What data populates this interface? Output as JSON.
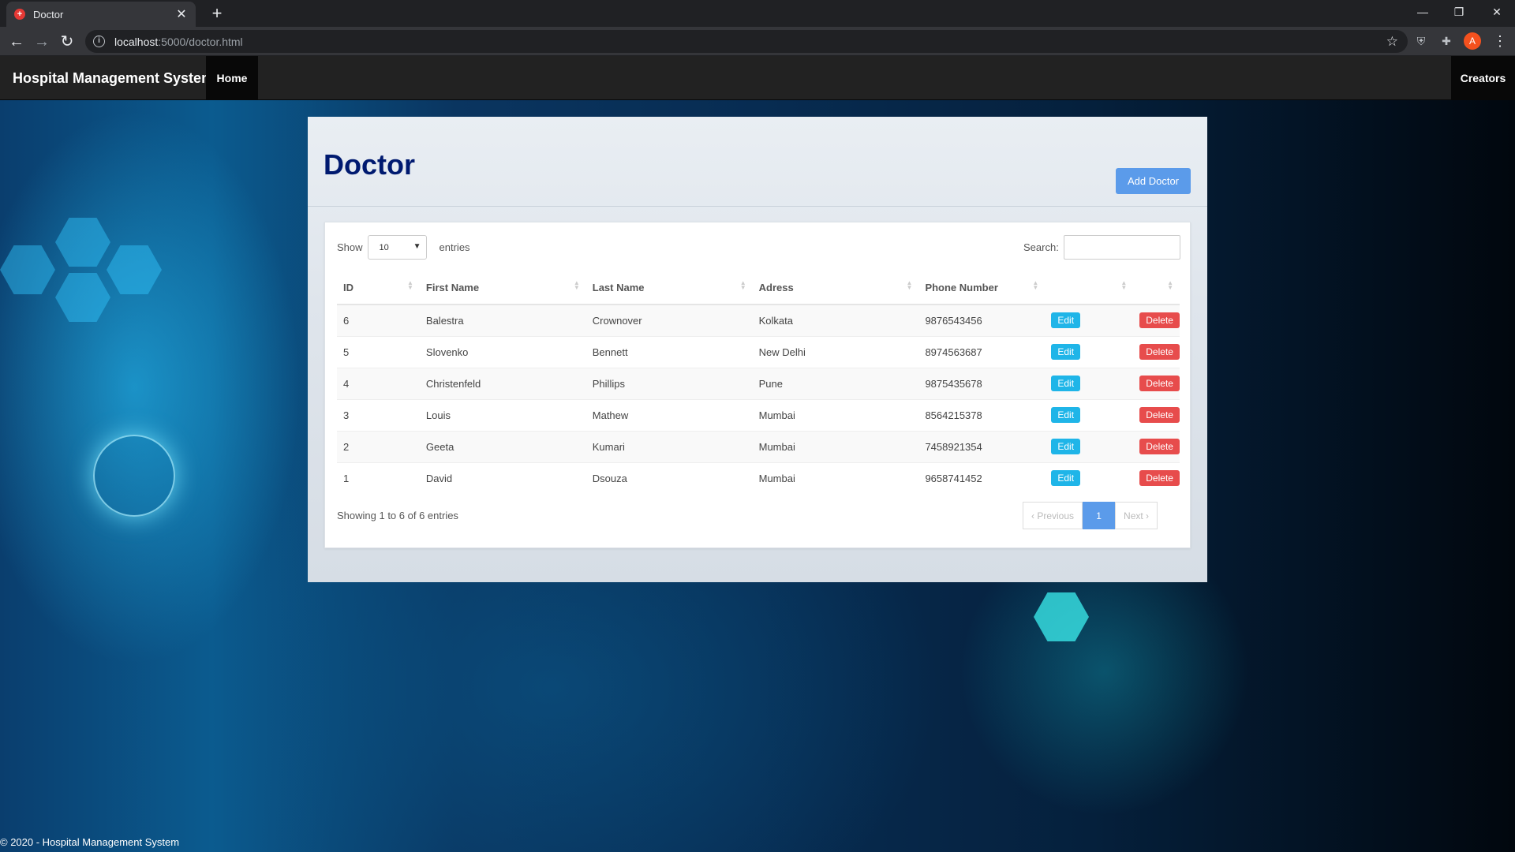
{
  "browser": {
    "tab_title": "Doctor",
    "tab_favicon": "hospital-favicon",
    "url_host": "localhost",
    "url_path": ":5000/doctor.html"
  },
  "navbar": {
    "brand": "Hospital Management System",
    "home": "Home",
    "creators": "Creators"
  },
  "panel": {
    "title": "Doctor",
    "add_button": "Add Doctor"
  },
  "controls": {
    "show_label": "Show",
    "page_size": "10",
    "entries_label": "entries",
    "search_label": "Search:"
  },
  "table": {
    "headers": [
      "ID",
      "First Name",
      "Last Name",
      "Adress",
      "Phone Number"
    ],
    "rows": [
      {
        "id": "6",
        "first": "Balestra",
        "last": "Crownover",
        "address": "Kolkata",
        "phone": "9876543456"
      },
      {
        "id": "5",
        "first": "Slovenko",
        "last": "Bennett",
        "address": "New Delhi",
        "phone": "8974563687"
      },
      {
        "id": "4",
        "first": "Christenfeld",
        "last": "Phillips",
        "address": "Pune",
        "phone": "9875435678"
      },
      {
        "id": "3",
        "first": "Louis",
        "last": "Mathew",
        "address": "Mumbai",
        "phone": "8564215378"
      },
      {
        "id": "2",
        "first": "Geeta",
        "last": "Kumari",
        "address": "Mumbai",
        "phone": "7458921354"
      },
      {
        "id": "1",
        "first": "David",
        "last": "Dsouza",
        "address": "Mumbai",
        "phone": "9658741452"
      }
    ],
    "edit_label": "Edit",
    "delete_label": "Delete"
  },
  "pagination": {
    "info": "Showing 1 to 6 of 6 entries",
    "previous": "Previous",
    "current": "1",
    "next": "Next"
  },
  "footer": "© 2020 - Hospital Management System",
  "colors": {
    "title": "#001a70",
    "primary": "#5b9bea",
    "edit": "#1fb5e8",
    "delete": "#e74c4c"
  }
}
